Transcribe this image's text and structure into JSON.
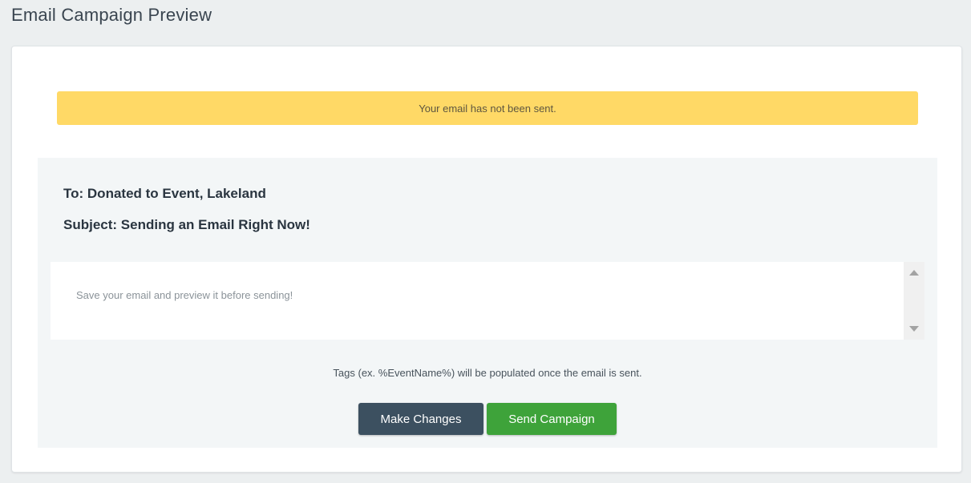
{
  "page": {
    "title": "Email Campaign Preview"
  },
  "alert": {
    "message": "Your email has not been sent.",
    "color": "#ffd966"
  },
  "preview": {
    "to_label": "To:",
    "to_value": "Donated to Event, Lakeland",
    "subject_label": "Subject:",
    "subject_value": "Sending an Email Right Now!",
    "body_text": "Save your email and preview it before sending!",
    "scroll_icons": [
      "scroll-up-icon",
      "scroll-down-icon"
    ]
  },
  "footer": {
    "tags_note": "Tags (ex. %EventName%) will be populated once the email is sent."
  },
  "actions": {
    "make_changes_label": "Make Changes",
    "send_campaign_label": "Send Campaign",
    "make_changes_color": "#3c5060",
    "send_campaign_color": "#3ea33a"
  }
}
